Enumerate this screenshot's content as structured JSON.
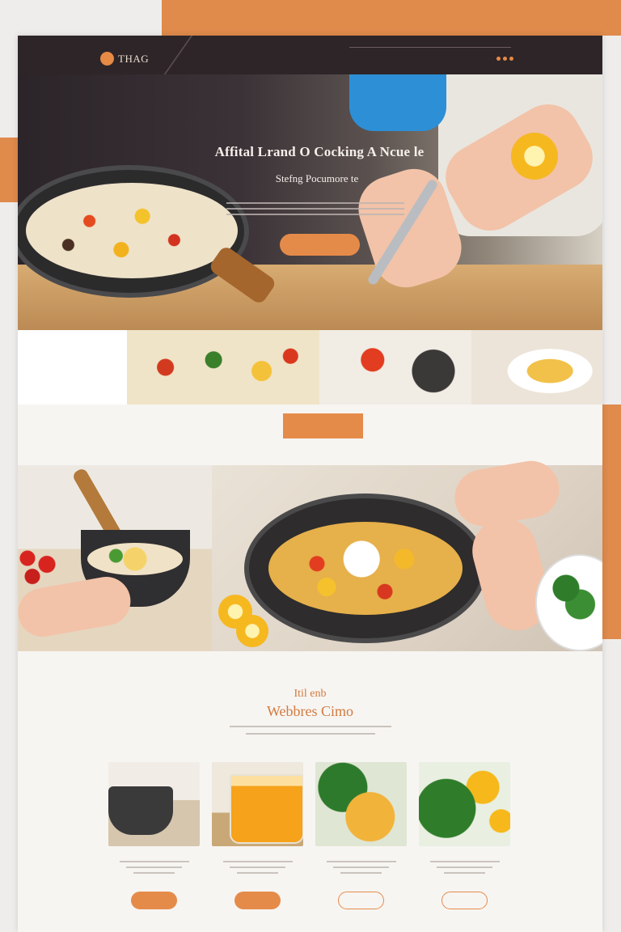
{
  "brand": {
    "name": "THAG"
  },
  "nav": {
    "links": [
      "",
      "",
      "",
      "",
      "",
      ""
    ],
    "cta": ""
  },
  "hero": {
    "title": "Affital Lrand O Cocking  A Ncue le",
    "subtitle": "Stefng Pocumore te",
    "button_label": ""
  },
  "section": {
    "button_label": ""
  },
  "about": {
    "kicker": "Itil enb",
    "title": "Webbres Cimo"
  },
  "cards": [
    {
      "image": "pot-on-stove",
      "button_label": "",
      "style": "filled"
    },
    {
      "image": "orange-juice-glass",
      "button_label": "",
      "style": "filled"
    },
    {
      "image": "herb-rice-bowl",
      "button_label": "",
      "style": "outline"
    },
    {
      "image": "lemon-salad",
      "button_label": "",
      "style": "outline"
    }
  ],
  "colors": {
    "accent": "#e58b4a",
    "nav_bg": "#2e2528",
    "heading": "#d27a3e"
  },
  "icons": {
    "logo": "orange-circle-logo",
    "menu_dots": "dots-icon"
  }
}
